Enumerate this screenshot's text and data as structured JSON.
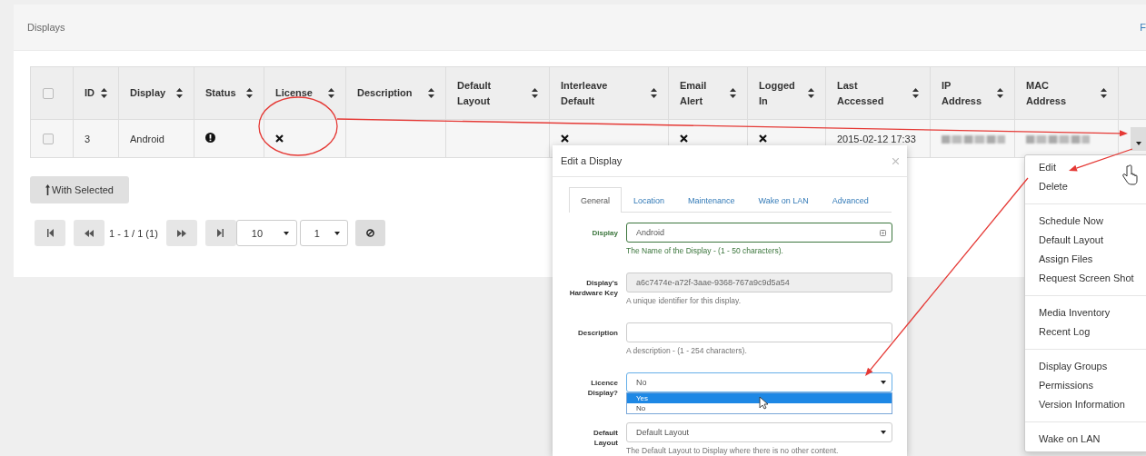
{
  "panel": {
    "title": "Displays",
    "link": "F"
  },
  "table": {
    "select_all": {
      "checked": false
    },
    "columns": [
      {
        "label": "ID",
        "sortable": true
      },
      {
        "label": "Display",
        "sortable": true
      },
      {
        "label": "Status",
        "sortable": true
      },
      {
        "label": "License",
        "sortable": true
      },
      {
        "label": "Description",
        "sortable": true
      },
      {
        "label": "Default Layout",
        "sortable": true
      },
      {
        "label": "Interleave Default",
        "sortable": true
      },
      {
        "label": "Email Alert",
        "sortable": true
      },
      {
        "label": "Logged In",
        "sortable": true
      },
      {
        "label": "Last Accessed",
        "sortable": true
      },
      {
        "label": "IP Address",
        "sortable": true
      },
      {
        "label": "MAC Address",
        "sortable": true
      }
    ],
    "rows": [
      {
        "checked": false,
        "cells": [
          {
            "kind": "text",
            "text": "3"
          },
          {
            "kind": "text",
            "text": "Android"
          },
          {
            "kind": "alert"
          },
          {
            "kind": "cross"
          },
          {
            "kind": "empty"
          },
          {
            "kind": "empty"
          },
          {
            "kind": "cross"
          },
          {
            "kind": "cross"
          },
          {
            "kind": "cross"
          },
          {
            "kind": "text",
            "text": "2015-02-12 17:33"
          },
          {
            "kind": "blurred"
          },
          {
            "kind": "blurred"
          }
        ]
      }
    ]
  },
  "with_selected_button": "With Selected",
  "pagination": {
    "range": "1 - 1 / 1 (1)",
    "page_size": "10",
    "page": "1"
  },
  "modal": {
    "title": "Edit a Display",
    "tabs": [
      {
        "label": "General",
        "selected": true
      },
      {
        "label": "Location",
        "selected": false
      },
      {
        "label": "Maintenance",
        "selected": false
      },
      {
        "label": "Wake on LAN",
        "selected": false
      },
      {
        "label": "Advanced",
        "selected": false
      }
    ],
    "fields": [
      {
        "kind": "text",
        "label": "Display",
        "value": "Android",
        "help": "The Name of the Display - (1 - 50 characters).",
        "valid": true,
        "disabled": false
      },
      {
        "kind": "text",
        "label": "Display's Hardware Key",
        "value": "a6c7474e-a72f-3aae-9368-767a9c9d5a54",
        "help": "A unique identifier for this display.",
        "valid": false,
        "disabled": true
      },
      {
        "kind": "text",
        "label": "Description",
        "help": "A description - (1 - 254 characters).",
        "valid": false,
        "disabled": false
      },
      {
        "kind": "select",
        "label": "Licence Display?",
        "value": "No",
        "expanded": true,
        "options": [
          {
            "label": "Yes",
            "highlighted": true
          },
          {
            "label": "No",
            "highlighted": false
          }
        ]
      },
      {
        "kind": "select",
        "label": "Default Layout",
        "value": "Default Layout",
        "expanded": false,
        "help": "The Default Layout to Display where there is no other content."
      }
    ]
  },
  "menu": {
    "groups": [
      {
        "items": [
          "Edit",
          "Delete"
        ]
      },
      {
        "items": [
          "Schedule Now",
          "Default Layout",
          "Assign Files",
          "Request Screen Shot"
        ]
      },
      {
        "items": [
          "Media Inventory",
          "Recent Log"
        ]
      },
      {
        "items": [
          "Display Groups",
          "Permissions",
          "Version Information"
        ]
      },
      {
        "items": [
          "Wake on LAN"
        ]
      }
    ]
  }
}
